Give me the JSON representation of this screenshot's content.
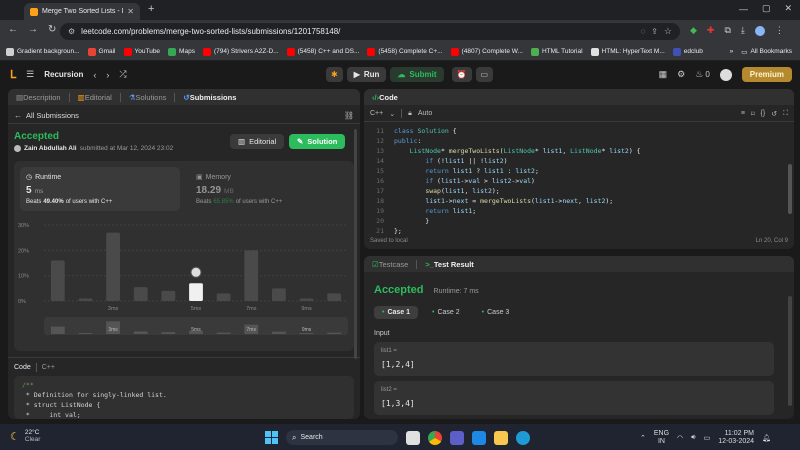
{
  "browser": {
    "tab_title": "Merge Two Sorted Lists - Leet",
    "url": "leetcode.com/problems/merge-two-sorted-lists/submissions/1201758148/",
    "bookmarks": [
      {
        "label": "Gradient backgroun...",
        "color": "#cfcfcf"
      },
      {
        "label": "Gmail",
        "color": "#ea4335"
      },
      {
        "label": "YouTube",
        "color": "#ff0000"
      },
      {
        "label": "Maps",
        "color": "#34a853"
      },
      {
        "label": "(794) Strivers A2Z-D...",
        "color": "#ff0000"
      },
      {
        "label": "(5458) C++ and DS...",
        "color": "#ff0000"
      },
      {
        "label": "(5458) Complete C+...",
        "color": "#ff0000"
      },
      {
        "label": "(4807) Complete W...",
        "color": "#ff0000"
      },
      {
        "label": "HTML Tutorial",
        "color": "#4caf50"
      },
      {
        "label": "HTML: HyperText M...",
        "color": "#e0e0e0"
      },
      {
        "label": "edclub",
        "color": "#3f51b5"
      }
    ],
    "all_bookmarks": "All Bookmarks"
  },
  "header": {
    "problem_list": "Recursion",
    "run": "Run",
    "submit": "Submit",
    "fire_count": "0",
    "premium": "Premium"
  },
  "left": {
    "tabs": [
      "Description",
      "Editorial",
      "Solutions",
      "Submissions"
    ],
    "back": "All Submissions",
    "status": "Accepted",
    "author": "Zain Abdullah Ali",
    "submitted": "submitted at Mar 12, 2024 23:02",
    "editorial_btn": "Editorial",
    "solution_btn": "Solution",
    "runtime_label": "Runtime",
    "runtime_value": "5",
    "runtime_unit": "ms",
    "runtime_beats_prefix": "Beats",
    "runtime_beats": "49.40%",
    "runtime_beats_suffix": "of users with C++",
    "memory_label": "Memory",
    "memory_value": "18.29",
    "memory_unit": "MB",
    "memory_beats_prefix": "Beats",
    "memory_beats": "65.85%",
    "memory_beats_suffix": "of users with C++",
    "code_label": "Code",
    "code_lang": "C++",
    "code_lines": [
      "/**",
      " * Definition for singly-linked list.",
      " * struct ListNode {",
      " *     int val;"
    ]
  },
  "chart_data": {
    "type": "bar",
    "y_ticks": [
      "30%",
      "20%",
      "10%",
      "0%"
    ],
    "ylim": [
      0,
      30
    ],
    "x_tick_labels": [
      "3ms",
      "5ms",
      "7ms",
      "9ms"
    ],
    "values": [
      16,
      1,
      27,
      5.5,
      4,
      7,
      3,
      20,
      5,
      1,
      3
    ],
    "highlight_index": 5
  },
  "editor": {
    "title": "Code",
    "lang": "C++",
    "mode": "Auto",
    "saved": "Saved to local",
    "cursor": "Ln 20, Col 9"
  },
  "result": {
    "tab_testcase": "Testcase",
    "tab_result": "Test Result",
    "status": "Accepted",
    "runtime": "Runtime: 7 ms",
    "cases": [
      "Case 1",
      "Case 2",
      "Case 3"
    ],
    "input_label": "Input",
    "var1": "list1 =",
    "val1": "[1,2,4]",
    "var2": "list2 =",
    "val2": "[1,3,4]"
  },
  "taskbar": {
    "temp": "22°C",
    "weather": "Clear",
    "search": "Search",
    "lang1": "ENG",
    "lang2": "IN",
    "time": "11:02 PM",
    "date": "12-03-2024"
  }
}
